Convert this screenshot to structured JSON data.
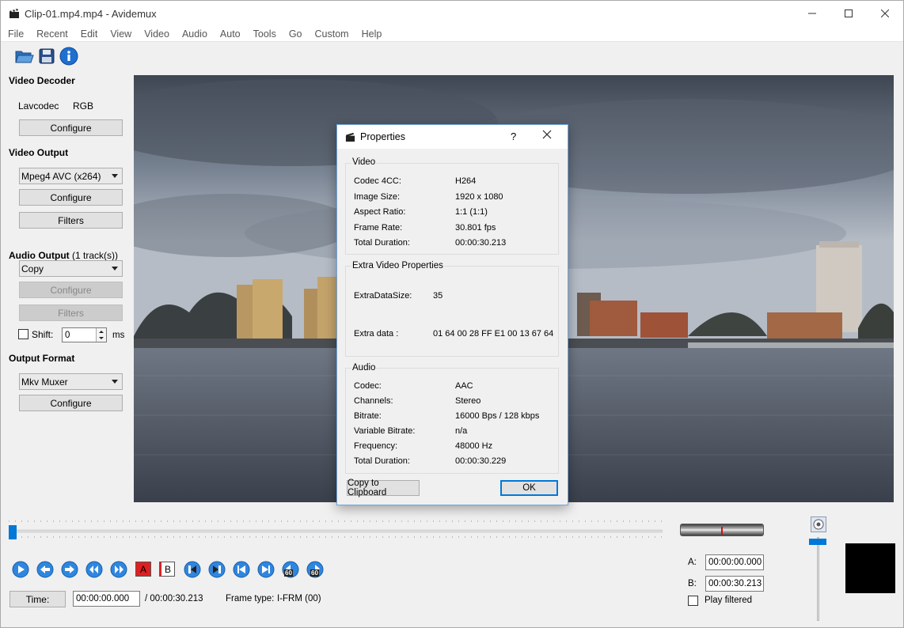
{
  "window": {
    "title": "Clip-01.mp4.mp4 - Avidemux"
  },
  "menu": [
    "File",
    "Recent",
    "Edit",
    "View",
    "Video",
    "Audio",
    "Auto",
    "Tools",
    "Go",
    "Custom",
    "Help"
  ],
  "left": {
    "video_decoder_title": "Video Decoder",
    "decoder_name": "Lavcodec",
    "decoder_format": "RGB",
    "decoder_configure": "Configure",
    "video_output_title": "Video Output",
    "video_codec": "Mpeg4 AVC (x264)",
    "video_configure": "Configure",
    "video_filters": "Filters",
    "audio_output_title": "Audio Output",
    "audio_tracks": "(1 track(s))",
    "audio_codec": "Copy",
    "audio_configure": "Configure",
    "audio_filters": "Filters",
    "shift_label": "Shift:",
    "shift_value": "0",
    "shift_unit": "ms",
    "output_format_title": "Output Format",
    "muxer": "Mkv Muxer",
    "muxer_configure": "Configure"
  },
  "dialog": {
    "title": "Properties",
    "help": "?",
    "video_group": "Video",
    "video": [
      {
        "label": "Codec 4CC:",
        "value": "H264"
      },
      {
        "label": "Image Size:",
        "value": "1920 x 1080"
      },
      {
        "label": "Aspect Ratio:",
        "value": "1:1 (1:1)"
      },
      {
        "label": "Frame Rate:",
        "value": "30.801 fps"
      },
      {
        "label": "Total Duration:",
        "value": "00:00:30.213"
      }
    ],
    "extra_group": "Extra Video Properties",
    "extra_size_label": "ExtraDataSize:",
    "extra_size_value": "35",
    "extra_data_label": "Extra data :",
    "extra_data_value": "01 64 00 28 FF E1 00 13 67 64",
    "audio_group": "Audio",
    "audio": [
      {
        "label": "Codec:",
        "value": "AAC"
      },
      {
        "label": "Channels:",
        "value": "Stereo"
      },
      {
        "label": "Bitrate:",
        "value": "16000 Bps / 128 kbps"
      },
      {
        "label": "Variable Bitrate:",
        "value": "n/a"
      },
      {
        "label": "Frequency:",
        "value": "48000 Hz"
      },
      {
        "label": "Total Duration:",
        "value": "00:00:30.229"
      }
    ],
    "copy_button": "Copy to Clipboard",
    "ok_button": "OK"
  },
  "bottom": {
    "time_button": "Time:",
    "current_time": "00:00:00.000",
    "total_time": "/ 00:00:30.213",
    "frame_type_label": "Frame type:",
    "frame_type_value": "I-FRM (00)",
    "a_label": "A:",
    "a_value": "00:00:00.000",
    "b_label": "B:",
    "b_value": "00:00:30.213",
    "play_filtered": "Play filtered",
    "marker_a": "A",
    "marker_b": "B",
    "seek_60": "60"
  },
  "colors": {
    "accent": "#0078d7",
    "marker_red": "#e02020"
  }
}
